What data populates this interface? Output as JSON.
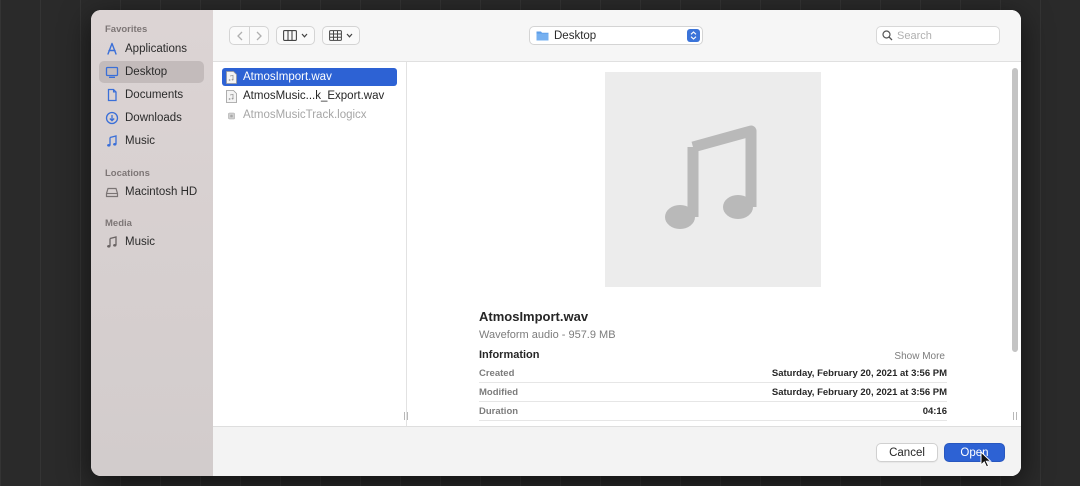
{
  "sidebar": {
    "sections": [
      {
        "label": "Favorites",
        "items": [
          {
            "label": "Applications",
            "icon": "applications-icon"
          },
          {
            "label": "Desktop",
            "icon": "desktop-icon",
            "selected": true
          },
          {
            "label": "Documents",
            "icon": "document-icon"
          },
          {
            "label": "Downloads",
            "icon": "download-icon"
          },
          {
            "label": "Music",
            "icon": "music-note-icon"
          }
        ]
      },
      {
        "label": "Locations",
        "items": [
          {
            "label": "Macintosh HD",
            "icon": "hard-drive-icon"
          }
        ]
      },
      {
        "label": "Media",
        "items": [
          {
            "label": "Music",
            "icon": "music-note-icon"
          }
        ]
      }
    ]
  },
  "toolbar": {
    "location": "Desktop",
    "search_placeholder": "Search"
  },
  "files": [
    {
      "name": "AtmosImport.wav",
      "selected": true
    },
    {
      "name": "AtmosMusic...k_Export.wav"
    },
    {
      "name": "AtmosMusicTrack.logicx",
      "disabled": true
    }
  ],
  "preview": {
    "name": "AtmosImport.wav",
    "kind": "Waveform audio - 957.9 MB",
    "info_heading": "Information",
    "show_more": "Show More",
    "rows": [
      {
        "key": "Created",
        "value": "Saturday, February 20, 2021 at 3:56 PM"
      },
      {
        "key": "Modified",
        "value": "Saturday, February 20, 2021 at 3:56 PM"
      },
      {
        "key": "Duration",
        "value": "04:16"
      }
    ]
  },
  "footer": {
    "cancel_label": "Cancel",
    "open_label": "Open"
  },
  "colors": {
    "accent": "#2d62d4",
    "sidebar_bg": "#d6cfcf"
  }
}
